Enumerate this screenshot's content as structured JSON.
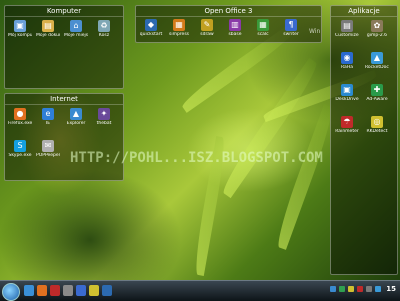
{
  "panels": {
    "komputer": {
      "title": "Komputer",
      "items": [
        {
          "label": "Mój komputer",
          "glyph": "▣",
          "color": "#6aa0d8"
        },
        {
          "label": "Moje dokumenty",
          "glyph": "▤",
          "color": "#d9b04a"
        },
        {
          "label": "Moje miejsca sieciowe",
          "glyph": "⌂",
          "color": "#4c8fd0"
        },
        {
          "label": "Kosz",
          "glyph": "♻",
          "color": "#7fa7b5"
        }
      ]
    },
    "internet": {
      "title": "Internet",
      "items": [
        {
          "label": "Firefox.exe",
          "glyph": "●",
          "color": "#e07020"
        },
        {
          "label": "IE",
          "glyph": "e",
          "color": "#2f7fd8"
        },
        {
          "label": "Explorer",
          "glyph": "▲",
          "color": "#3a8ad0"
        },
        {
          "label": "thebat",
          "glyph": "✦",
          "color": "#6a4a9a"
        },
        {
          "label": "Skype.exe",
          "glyph": "S",
          "color": "#14a0e0"
        },
        {
          "label": "POPPeeper",
          "glyph": "✉",
          "color": "#b0b0b0"
        }
      ]
    },
    "openoffice": {
      "title": "Open Office 3",
      "items": [
        {
          "label": "quickstart",
          "glyph": "◆",
          "color": "#2c6ab0"
        },
        {
          "label": "simpress",
          "glyph": "▦",
          "color": "#d27a1a"
        },
        {
          "label": "sdraw",
          "glyph": "✎",
          "color": "#c0a020"
        },
        {
          "label": "sbase",
          "glyph": "▥",
          "color": "#8a3aa8"
        },
        {
          "label": "scalc",
          "glyph": "▦",
          "color": "#3a9a3a"
        },
        {
          "label": "swriter",
          "glyph": "¶",
          "color": "#3a6ad0"
        }
      ],
      "overflow_text": "Windo"
    },
    "aplikacje": {
      "title": "Aplikacje",
      "items": [
        {
          "label": "Customize Fences",
          "glyph": "▤",
          "color": "#7a7a7a"
        },
        {
          "label": "gimp-2.6",
          "glyph": "✿",
          "color": "#8a7a5a"
        },
        {
          "label": "RaHa",
          "glyph": "◉",
          "color": "#2a6ad0"
        },
        {
          "label": "RocketDock",
          "glyph": "▲",
          "color": "#3a9ad8"
        },
        {
          "label": "DeskDrive",
          "glyph": "▣",
          "color": "#2a8ad0"
        },
        {
          "label": "Ad-Aware",
          "glyph": "✚",
          "color": "#2a9a4a"
        },
        {
          "label": "Rainmeter",
          "glyph": "☂",
          "color": "#c02a2a"
        },
        {
          "label": "RKDetect",
          "glyph": "◎",
          "color": "#d0c030"
        }
      ]
    }
  },
  "watermark": "HTTP://POHL...ISZ.BLOGSPOT.COM",
  "taskbar": {
    "clock": "15",
    "tasks": [
      "#3a90d8",
      "#e07020",
      "#c02a2a",
      "#8a8a8a",
      "#3a6ad0",
      "#d0c030",
      "#2c6ab0"
    ],
    "tray": [
      "#3a8ad0",
      "#30a050",
      "#d0c030",
      "#c02a2a",
      "#7a7a7a",
      "#3a9ad8"
    ]
  }
}
